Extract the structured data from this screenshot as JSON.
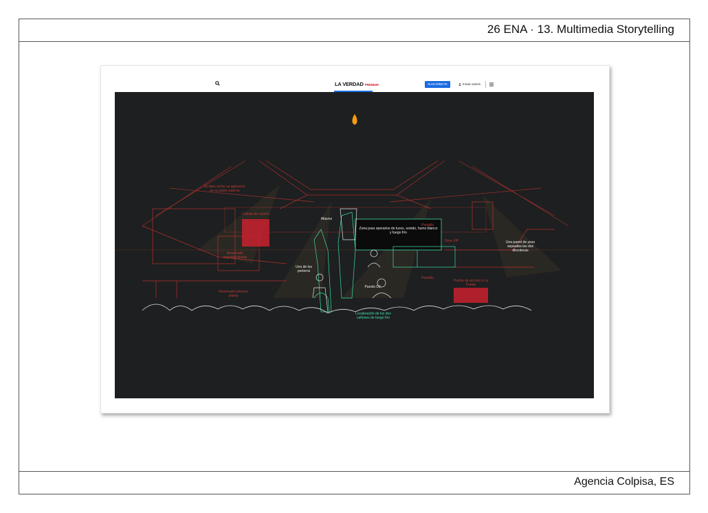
{
  "page": {
    "header_title": "26 ENA · 13. Multimedia Storytelling",
    "footer_credit": "Agencia Colpisa, ES"
  },
  "site": {
    "logo": "LA VERDAD",
    "logo_sub": "PREMIUM",
    "subscribe_label": "SUSCRÍBETE",
    "login_label": "Iniciar sesión",
    "icons": [
      "search-icon",
      "user-icon",
      "menu-icon",
      "flame-icon"
    ]
  },
  "colors": {
    "scene_bg": "#1d1f20",
    "red_lines": "#b8312f",
    "green_lines": "#3fe0a6",
    "white_lines": "#e6e6e6",
    "subscribe_bg": "#1a6be3",
    "flame": "#f39c12"
  },
  "labels": {
    "falso_techo": "El falso techo se aglomeró en su parte externa",
    "cabina": "Cabina de control",
    "reservado_2": "Reservado segunda planta",
    "reservado_1": "Reservado primera planta",
    "altavoz": "Altavoz",
    "zona_operarios": "Zona para operarios de luces, sonido, humo blanco y fuego frío",
    "pantalla_1": "Pantalla",
    "zona_vip": "Zona VIP",
    "pared_yeso": "Una pared de yeso separaba las dos discotecas",
    "porteros": "Uno de los porteros",
    "puesto_dj": "Puesto DJ",
    "pantalla_2": "Pantalla",
    "puerta": "Puerta de acceso a La Fonda",
    "canones": "Localización de los dos cañones de fuego frío"
  }
}
